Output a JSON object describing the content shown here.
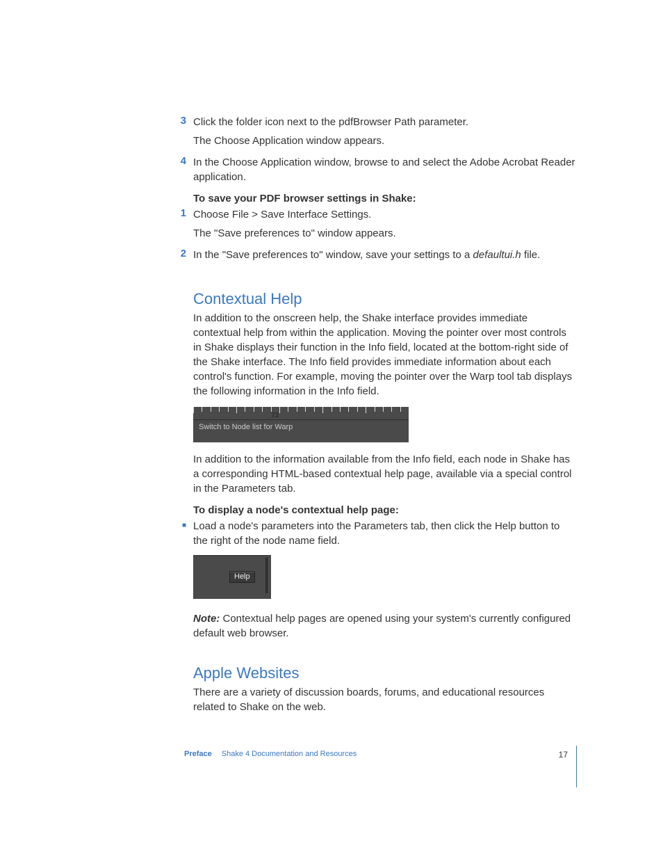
{
  "steps_top": [
    {
      "num": "3",
      "line1": "Click the folder icon next to the pdfBrowser Path parameter.",
      "line2": "The Choose Application window appears."
    },
    {
      "num": "4",
      "line1": "In the Choose Application window, browse to and select the Adobe Acrobat Reader application."
    }
  ],
  "save_heading": "To save your PDF browser settings in Shake:",
  "steps_save": [
    {
      "num": "1",
      "line1": "Choose File > Save Interface Settings.",
      "line2": "The \"Save preferences to\" window appears."
    },
    {
      "num": "2",
      "line1_pre": "In the \"Save preferences to\" window, save your settings to a ",
      "line1_em": "defaultui.h",
      "line1_post": " file."
    }
  ],
  "section1": {
    "title": "Contextual Help",
    "para1": "In addition to the onscreen help, the Shake interface provides immediate contextual help from within the application. Moving the pointer over most controls in Shake displays their function in the Info field, located at the bottom-right side of the Shake interface. The Info field provides immediate information about each control's function. For example, moving the pointer over the Warp tool tab displays the following information in the Info field."
  },
  "figure1": {
    "ruler_value": "73",
    "info_text": "Switch to Node list for Warp"
  },
  "section1b": {
    "para2": "In addition to the information available from the Info field, each node in Shake has a corresponding HTML-based contextual help page, available via a special control in the Parameters tab.",
    "display_heading": "To display a node's contextual help page:",
    "bullet": "Load a node's parameters into the Parameters tab, then click the Help button to the right of the node name field."
  },
  "figure2": {
    "button_label": "Help"
  },
  "note": {
    "label": "Note:",
    "text": "  Contextual help pages are opened using your system's currently configured default web browser."
  },
  "section2": {
    "title": "Apple Websites",
    "para": "There are a variety of discussion boards, forums, and educational resources related to Shake on the web."
  },
  "footer": {
    "preface": "Preface",
    "subtitle": "Shake 4 Documentation and Resources",
    "page": "17"
  }
}
